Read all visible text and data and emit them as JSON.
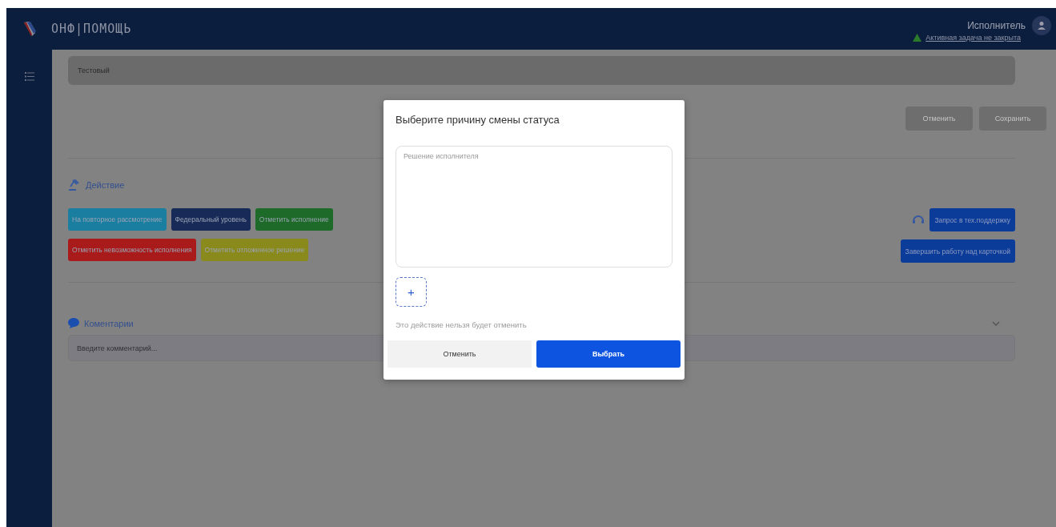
{
  "header": {
    "brand": "ОНФ|ПОМОЩЬ",
    "user_role": "Исполнитель",
    "warning_link": "Активная задача не закрыта"
  },
  "form": {
    "field_value": "Тестовый",
    "buttons": [
      {
        "label": "Отменить",
        "disabled": true
      },
      {
        "label": "Сохранить",
        "disabled": true
      }
    ]
  },
  "actions": {
    "title": "Действие",
    "button_rows": [
      [
        {
          "label": "На повторное рассмотрение",
          "color": "#1a7ea0"
        },
        {
          "label": "Федеральный уровень",
          "color": "#182a58"
        },
        {
          "label": "Отметить исполнение",
          "color": "#1e6a28"
        }
      ],
      [
        {
          "label": "Отметить невозможность исполнения",
          "color": "#a91b1b"
        },
        {
          "label": "Отметить отложенное решение",
          "color": "#8a8a1c"
        }
      ]
    ],
    "support_button": "Запрос в тех.поддержку",
    "finish_button": "Завершить работу над карточкой"
  },
  "comments": {
    "title": "Коментарии",
    "expanded": false,
    "placeholder": "Введите комментарий..."
  },
  "dialog": {
    "title": "Выберите причину смены статуса",
    "textarea_placeholder": "Решение исполнителя",
    "add_button": "+",
    "note": "Это действие нельзя будет отменить",
    "cancel_button": "Отменить",
    "confirm_button": "Выбрать"
  }
}
